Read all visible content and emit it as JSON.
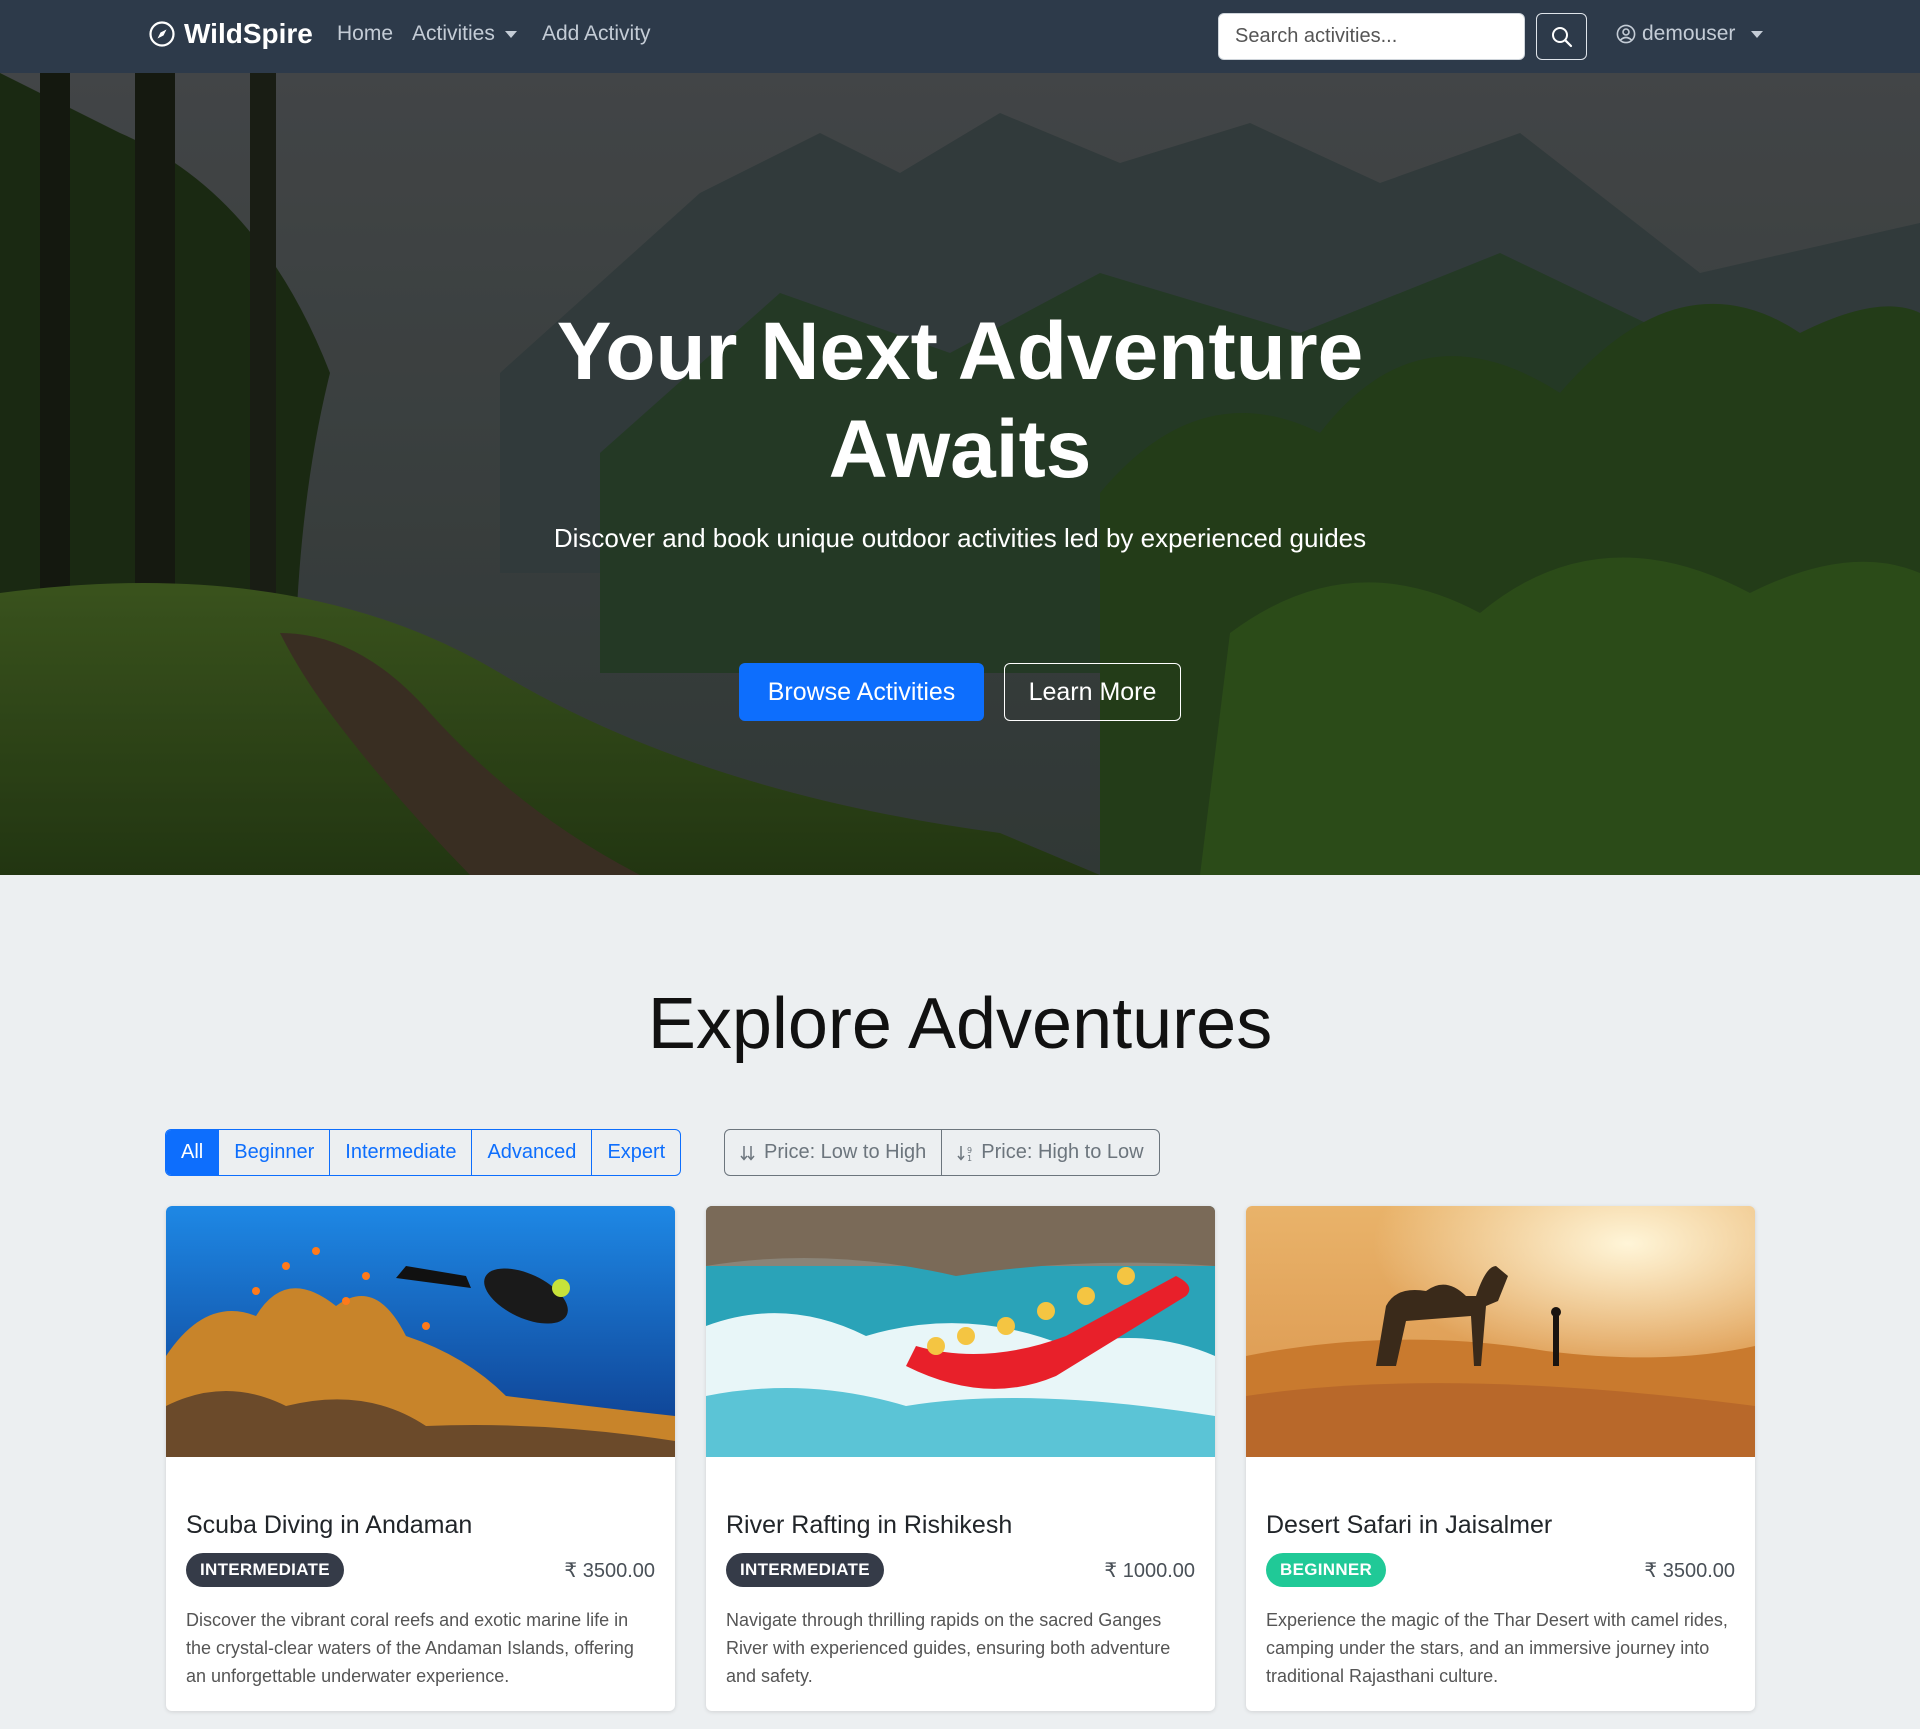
{
  "navbar": {
    "brand": "WildSpire",
    "links": {
      "home": "Home",
      "activities": "Activities",
      "add_activity": "Add Activity"
    },
    "search_placeholder": "Search activities...",
    "user": "demouser"
  },
  "hero": {
    "title": "Your Next Adventure Awaits",
    "subtitle": "Discover and book unique outdoor activities led by experienced guides",
    "primary_button": "Browse Activities",
    "secondary_button": "Learn More"
  },
  "explore": {
    "title": "Explore Adventures",
    "filters": [
      "All",
      "Beginner",
      "Intermediate",
      "Advanced",
      "Expert"
    ],
    "active_filter": "All",
    "sorts": [
      "Price: Low to High",
      "Price: High to Low"
    ]
  },
  "cards": [
    {
      "title": "Scuba Diving in Andaman",
      "level": "INTERMEDIATE",
      "price": "₹ 3500.00",
      "description": "Discover the vibrant coral reefs and exotic marine life in the crystal-clear waters of the Andaman Islands, offering an unforgettable underwater experience."
    },
    {
      "title": "River Rafting in Rishikesh",
      "level": "INTERMEDIATE",
      "price": "₹ 1000.00",
      "description": "Navigate through thrilling rapids on the sacred Ganges River with experienced guides, ensuring both adventure and safety."
    },
    {
      "title": "Desert Safari in Jaisalmer",
      "level": "BEGINNER",
      "price": "₹ 3500.00",
      "description": "Experience the magic of the Thar Desert with camel rides, camping under the stars, and an immersive journey into traditional Rajasthani culture."
    }
  ],
  "colors": {
    "navbar_bg": "#2d3a4a",
    "primary": "#0d6efd",
    "badge_intermediate": "#353b48",
    "badge_beginner": "#20c997",
    "page_bg": "#eceff1"
  }
}
